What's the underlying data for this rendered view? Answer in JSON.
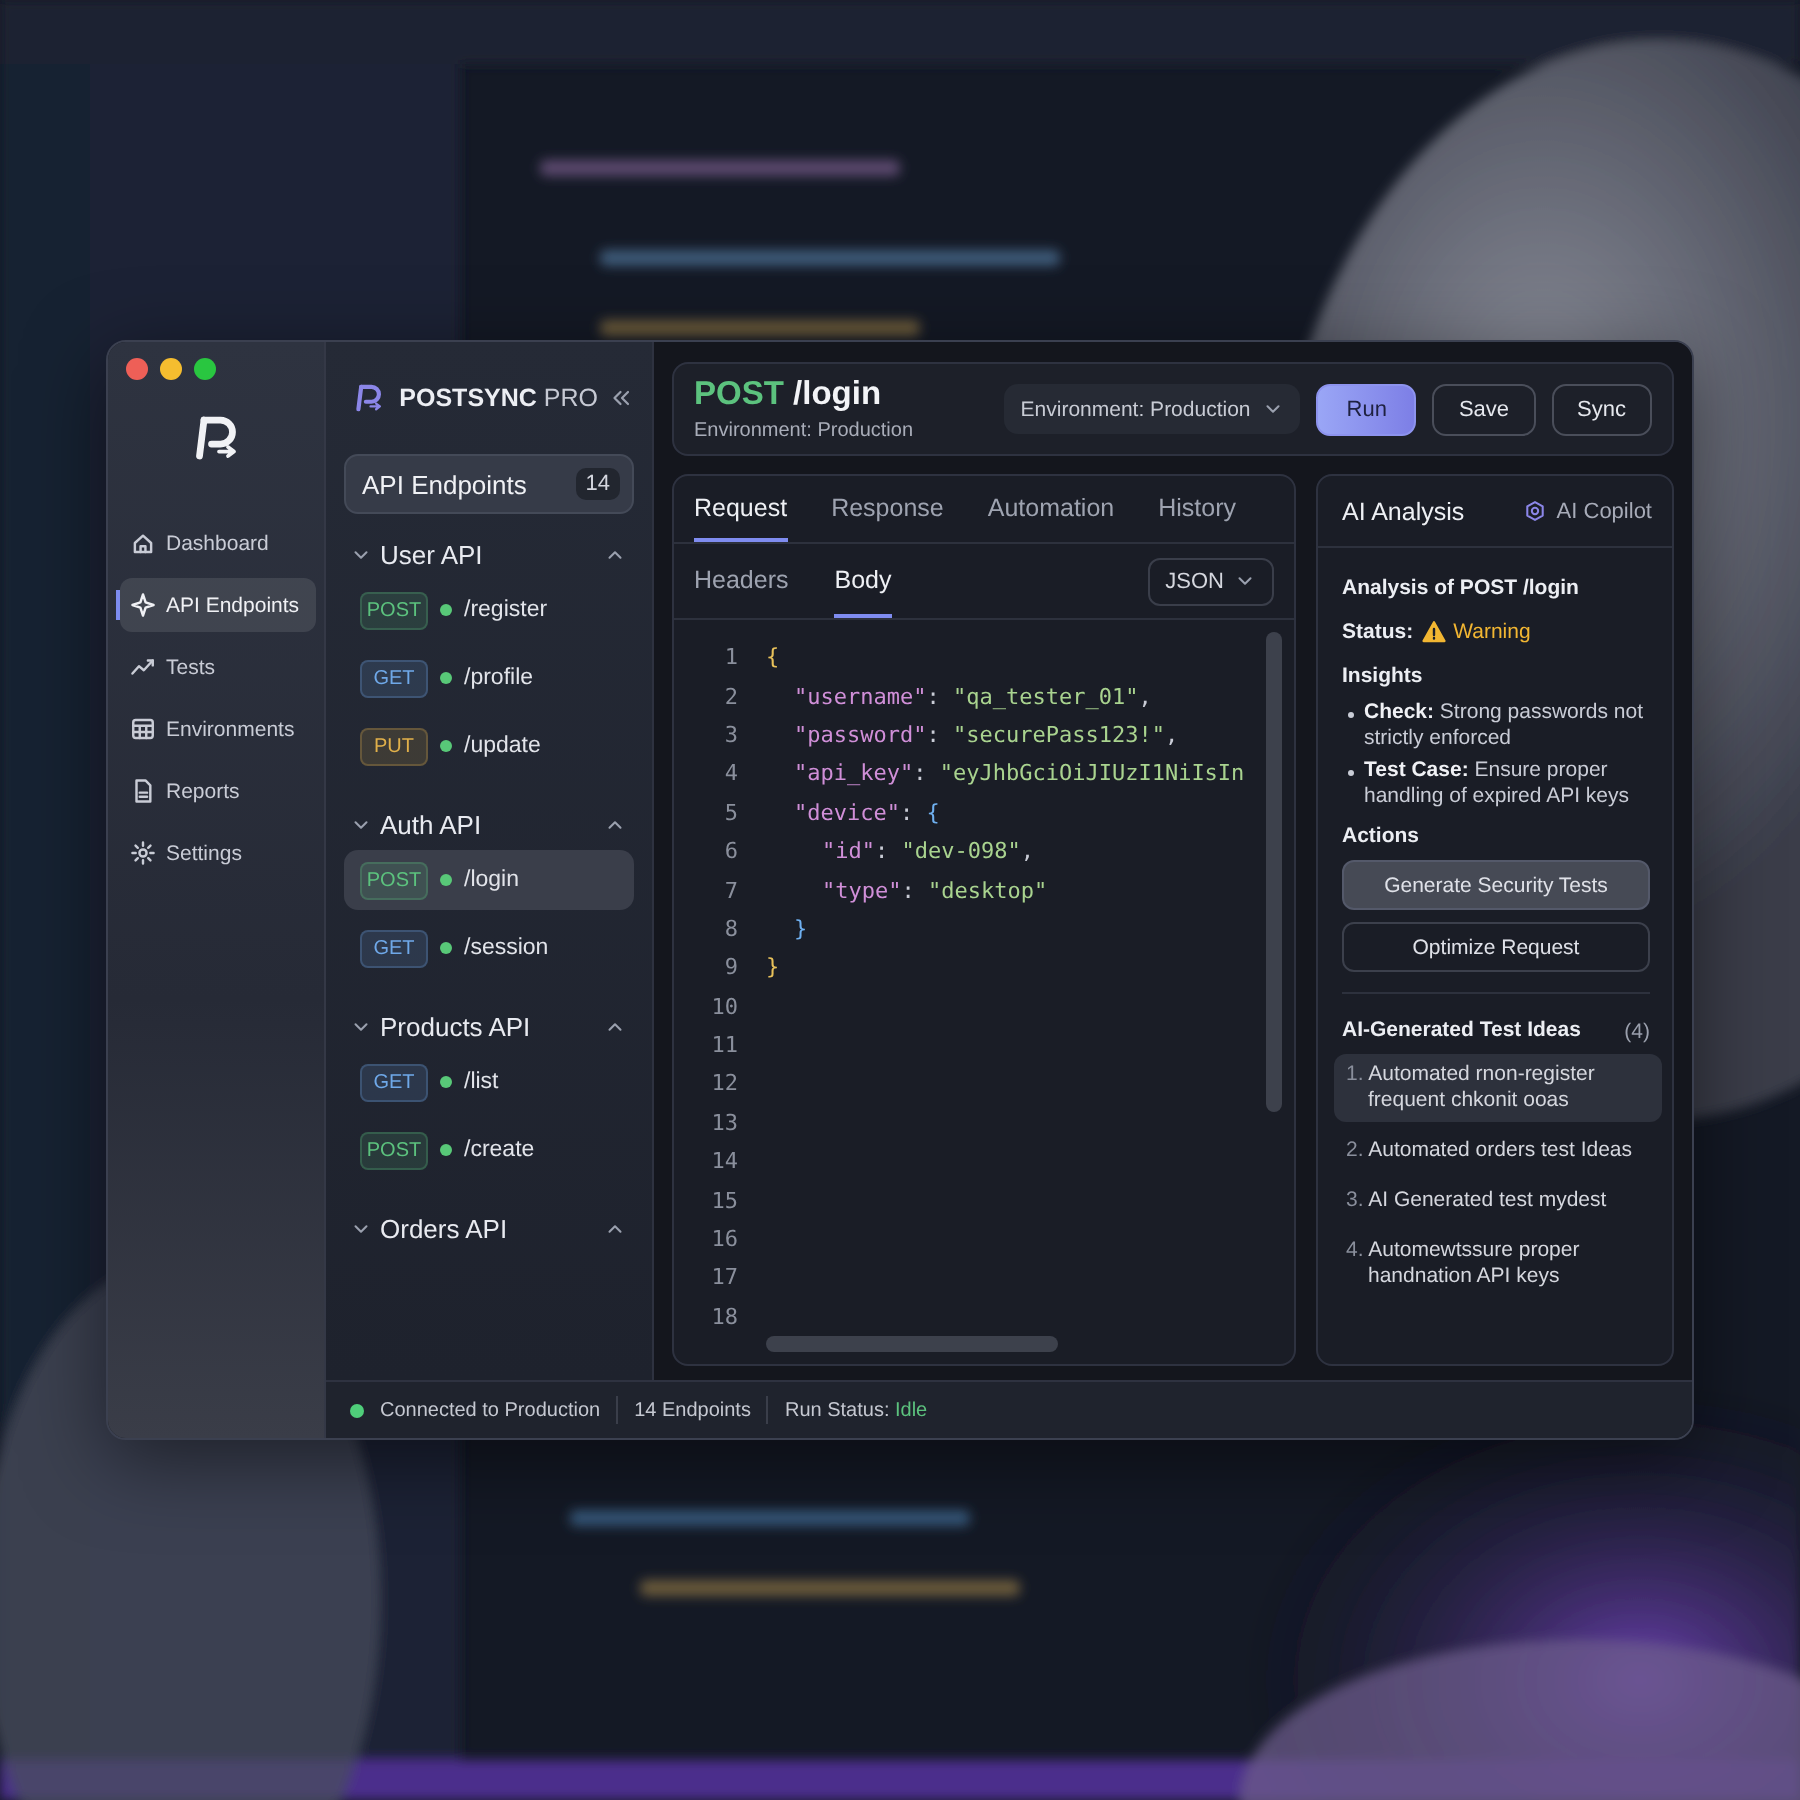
{
  "brand": {
    "name": "POSTSYNC",
    "edition": "PRO"
  },
  "nav": [
    {
      "label": "Dashboard",
      "kind": "home",
      "selected": false
    },
    {
      "label": "API Endpoints",
      "kind": "endpoints",
      "selected": true
    },
    {
      "label": "Tests",
      "kind": "trend",
      "selected": false
    },
    {
      "label": "Environments",
      "kind": "grid",
      "selected": false
    },
    {
      "label": "Reports",
      "kind": "document",
      "selected": false
    },
    {
      "label": "Settings",
      "kind": "gear",
      "selected": false
    }
  ],
  "endpoints": {
    "title": "API Endpoints",
    "count": "14",
    "groups": [
      {
        "name": "User API",
        "expanded": true,
        "items": [
          {
            "method": "POST",
            "color": "#5cc27e",
            "path": "/register",
            "selected": false
          },
          {
            "method": "GET",
            "color": "#6fa8e8",
            "path": "/profile",
            "selected": false
          },
          {
            "method": "PUT",
            "color": "#e0b04a",
            "path": "/update",
            "selected": false
          }
        ]
      },
      {
        "name": "Auth API",
        "expanded": true,
        "items": [
          {
            "method": "POST",
            "color": "#5cc27e",
            "path": "/login",
            "selected": true
          },
          {
            "method": "GET",
            "color": "#6fa8e8",
            "path": "/session",
            "selected": false
          }
        ]
      },
      {
        "name": "Products API",
        "expanded": true,
        "items": [
          {
            "method": "GET",
            "color": "#6fa8e8",
            "path": "/list",
            "selected": false
          },
          {
            "method": "POST",
            "color": "#5cc27e",
            "path": "/create",
            "selected": false
          }
        ]
      },
      {
        "name": "Orders API",
        "expanded": true
      }
    ]
  },
  "request": {
    "method": "POST",
    "path": "/login",
    "subtitle": "Environment: Production",
    "environment": "Environment: Production",
    "buttons": [
      {
        "label": "Run",
        "kind": "primary"
      },
      {
        "label": "Save",
        "kind": "outline"
      },
      {
        "label": "Sync",
        "kind": "outline"
      }
    ]
  },
  "tabs": [
    {
      "label": "Request",
      "selected": true
    },
    {
      "label": "Response",
      "selected": false
    },
    {
      "label": "Automation",
      "selected": false
    },
    {
      "label": "History",
      "selected": false
    }
  ],
  "subtabs": [
    {
      "label": "Headers",
      "selected": false
    },
    {
      "label": "Body",
      "selected": true
    }
  ],
  "format": "JSON",
  "editor": [
    {
      "number": "1",
      "tokens": [
        {
          "kind": "open",
          "text": "{"
        }
      ]
    },
    {
      "number": "2",
      "tokens": [
        {
          "kind": "key",
          "text": "\"username\""
        },
        {
          "kind": "punct",
          "text": ": "
        },
        {
          "kind": "string",
          "text": "\"qa_tester_01\""
        },
        {
          "kind": "punct",
          "text": ","
        }
      ]
    },
    {
      "number": "3",
      "tokens": [
        {
          "kind": "key",
          "text": "\"password\""
        },
        {
          "kind": "punct",
          "text": ": "
        },
        {
          "kind": "string",
          "text": "\"securePass123!\""
        },
        {
          "kind": "punct",
          "text": ","
        }
      ]
    },
    {
      "number": "4",
      "tokens": [
        {
          "kind": "key",
          "text": "\"api_key\""
        },
        {
          "kind": "punct",
          "text": ": "
        },
        {
          "kind": "string",
          "text": "\"eyJhbGciOiJIUzI1NiIsIn"
        }
      ]
    },
    {
      "number": "5",
      "tokens": [
        {
          "kind": "key",
          "text": "\"device\""
        },
        {
          "kind": "punct",
          "text": ": "
        },
        {
          "kind": "open",
          "text": "{"
        }
      ]
    },
    {
      "number": "6",
      "tokens": [
        {
          "kind": "key",
          "text": "\"id\""
        },
        {
          "kind": "punct",
          "text": ": "
        },
        {
          "kind": "string",
          "text": "\"dev-098\""
        },
        {
          "kind": "punct",
          "text": ","
        }
      ]
    },
    {
      "number": "7",
      "tokens": [
        {
          "kind": "key",
          "text": "\"type\""
        },
        {
          "kind": "punct",
          "text": ": "
        },
        {
          "kind": "string",
          "text": "\"desktop\""
        }
      ]
    },
    {
      "number": "8",
      "tokens": [
        {
          "kind": "close",
          "text": "}"
        }
      ]
    },
    {
      "number": "9",
      "tokens": [
        {
          "kind": "close",
          "text": "}"
        }
      ]
    },
    {
      "number": "10"
    },
    {
      "number": "11"
    },
    {
      "number": "12"
    },
    {
      "number": "13"
    },
    {
      "number": "14"
    },
    {
      "number": "15"
    },
    {
      "number": "16"
    },
    {
      "number": "17"
    },
    {
      "number": "18"
    }
  ],
  "ai": {
    "title": "AI Analysis",
    "copilot": "AI Copilot",
    "heading": "Analysis of POST /login",
    "status_label": "Status:",
    "status": "Warning",
    "insights_title": "Insights",
    "insights": [
      "**Check:** Strong passwords not strictly enforced",
      "**Test Case:** Ensure proper handling of expired API keys"
    ],
    "actions_title": "Actions",
    "actions": [
      {
        "label": "Generate Security Tests",
        "kind": "primary"
      },
      {
        "label": "Optimize Request",
        "kind": "outline"
      }
    ],
    "ideas_title": "AI-Generated Test Ideas",
    "ideas_count": "(4)",
    "ideas": [
      {
        "number": "1.",
        "text": "Automated rnon-register frequent chkonit ooas",
        "selected": true
      },
      {
        "number": "2.",
        "text": "Automated orders test Ideas",
        "selected": false
      },
      {
        "number": "3.",
        "text": "AI Generated test mydest",
        "selected": false
      },
      {
        "number": "4.",
        "text": "Automewtssure proper handnation API keys",
        "selected": false
      }
    ]
  },
  "status_bar": {
    "connection": "Connected to Production",
    "connected": true,
    "endpoints": "14 Endpoints",
    "run_label": "Run Status:",
    "run_status": "Idle"
  }
}
